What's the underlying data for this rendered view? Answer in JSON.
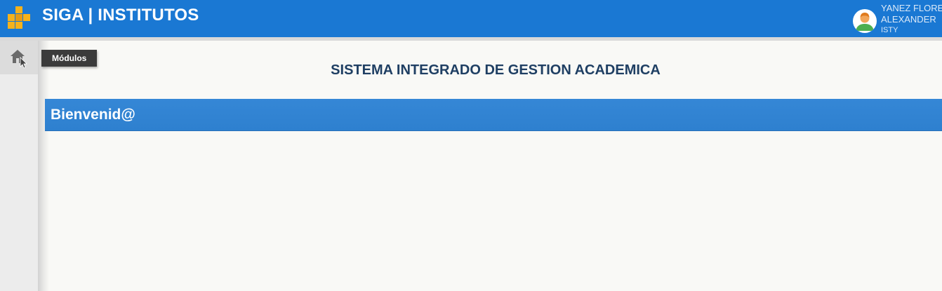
{
  "header": {
    "app_title": "SIGA | INSTITUTOS",
    "logo_icon": "grid-blocks-icon",
    "background_color": "#1a78d3"
  },
  "user": {
    "line1": "YANEZ FLORES",
    "line2": "ALEXANDER",
    "institute": "ISTY",
    "avatar_icon": "user-avatar-icon"
  },
  "sidebar": {
    "home_icon": "home-icon",
    "tooltip": "Módulos"
  },
  "main": {
    "system_title": "SISTEMA INTEGRADO DE GESTION ACADEMICA",
    "welcome_heading": "Bienvenid@",
    "panel_color": "#2e80cf"
  }
}
